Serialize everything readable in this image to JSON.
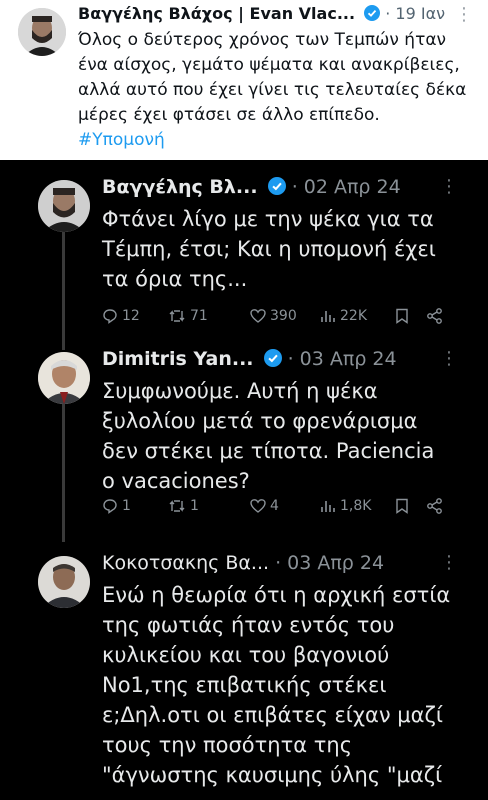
{
  "main_tweet": {
    "author": "Βαγγέλης Βλάχος | Evan Vlac...",
    "date": "· 19 Ιαν",
    "text": "Όλος ο δεύτερος χρόνος των Τεμπών ήταν ένα αίσχος, γεμάτο ψέματα και ανακρίβειες, αλλά αυτό που έχει γίνει τις τελευταίες δέκα μέρες έχει φτάσει σε άλλο επίπεδο.",
    "hashtag": "#Υπομονή",
    "verified": true
  },
  "thread": [
    {
      "author": "Βαγγέλης Βλ...",
      "date": "· 02 Απρ 24",
      "text": "Φτάνει λίγο με την ψέκα για τα Τέμπη, έτσι; Και η υπομονή έχει τα όρια της...",
      "replies": "12",
      "retweets": "71",
      "likes": "390",
      "views": "22K",
      "verified": true
    },
    {
      "author": "Dimitris Yan...",
      "date": "· 03 Απρ 24",
      "text": "Συμφωνούμε. Αυτή η ψέκα ξυλολίου μετά το φρενάρισμα δεν στέκει με τίποτα. Paciencia o vacaciones?",
      "replies": "1",
      "retweets": "1",
      "likes": "4",
      "views": "1,8K",
      "verified": true
    },
    {
      "author": "Κοκοτσακης Βα...",
      "date": "· 03 Απρ 24",
      "text": "Ενώ η θεωρία ότι η αρχική εστία της φωτιάς ήταν εντός του κυλικείου και του βαγονιού Νο1,της επιβατικής στέκει ε;Δηλ.οτι οι επιβάτες είχαν μαζί τους την ποσότητα της \"άγνωστης καυσιμης ύλης \"μαζί",
      "verified": false
    }
  ],
  "colors": {
    "verified": "#1d9bf0",
    "hashtag": "#1d9bf0",
    "muted": "#8b9298"
  }
}
